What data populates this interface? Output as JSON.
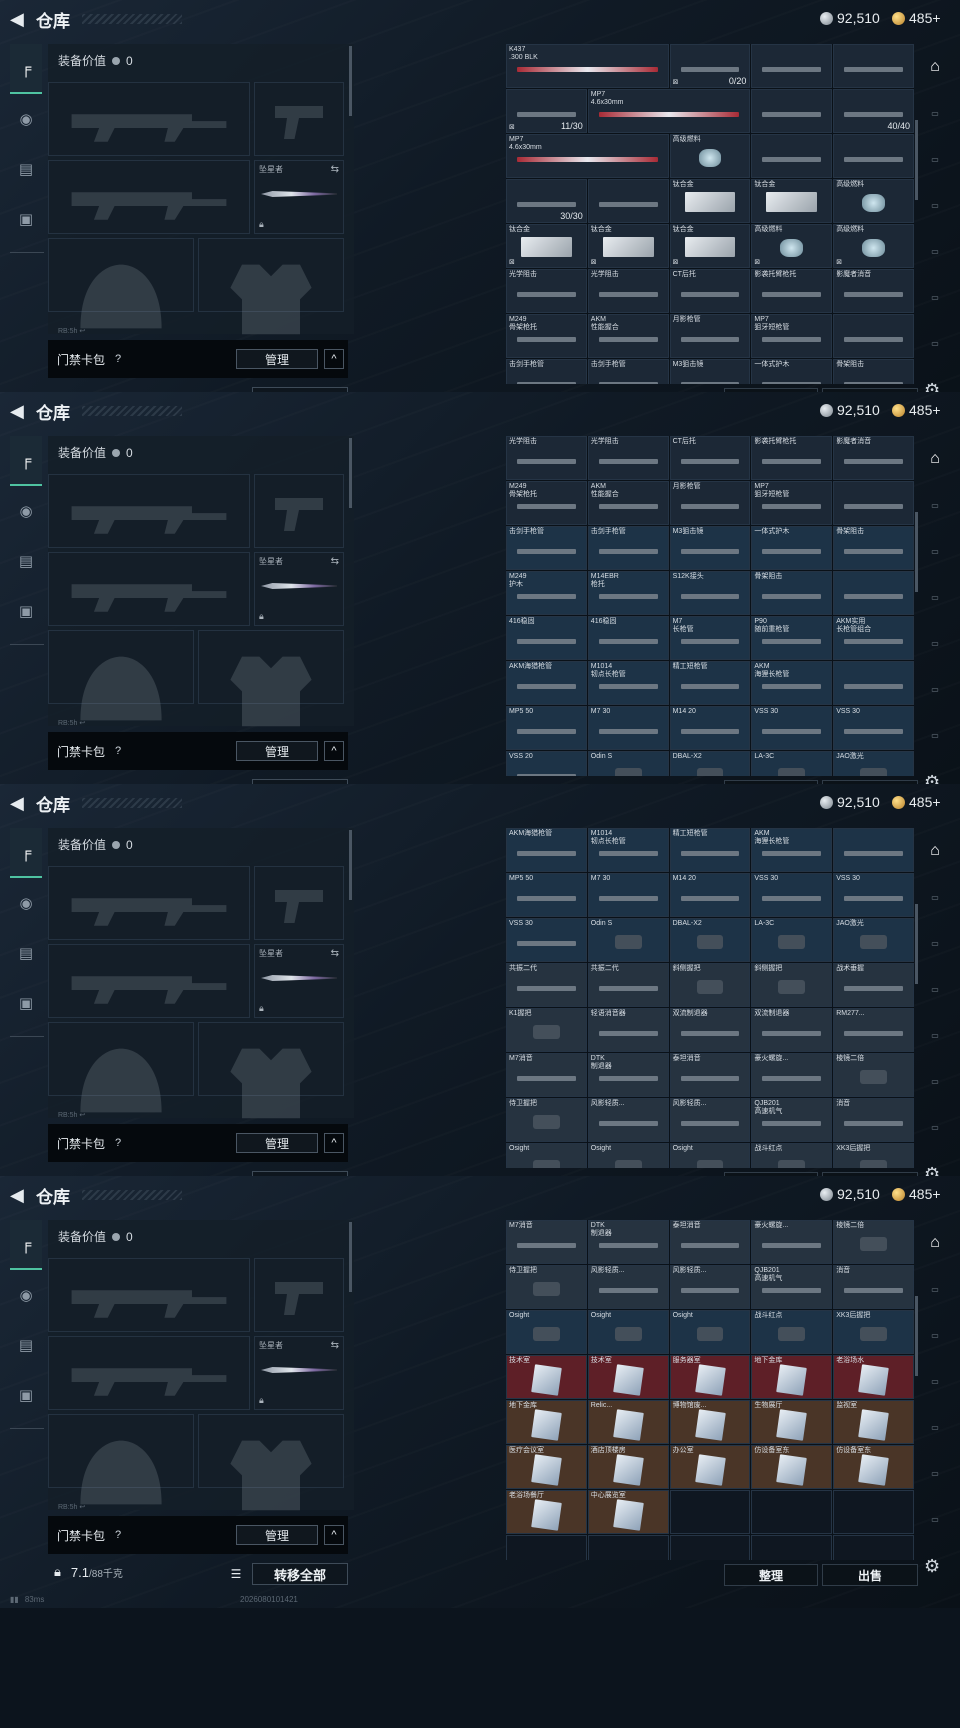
{
  "header": {
    "title": "仓库",
    "silver": "92,510",
    "gold": "485+"
  },
  "equip": {
    "value_label": "装备价值",
    "value": "0",
    "knife_label": "坠星者",
    "slot_tiny": "RB:5h  ↩"
  },
  "bag": {
    "name": "门禁卡包",
    "help": "?",
    "manage": "管理",
    "collapse": "^"
  },
  "weight": {
    "value": "7.1",
    "max": "/88千克"
  },
  "actions": {
    "transfer_all": "转移全部",
    "sort": "整理",
    "sell": "出售"
  },
  "footer": {
    "ping": "83ms",
    "code": "2026080101421"
  },
  "colors": {
    "accent": "#4fc3a1",
    "red_cell": "#5e1f27",
    "blue_cell": "#1d3347"
  },
  "frames": [
    {
      "cells": [
        {
          "name": "K437\n.300 BLK",
          "t": "red",
          "span": 2
        },
        {
          "name": "",
          "t": "",
          "cnt": "0/20",
          "badge": "⊠"
        },
        {
          "name": "",
          "t": ""
        },
        {
          "name": "",
          "t": ""
        },
        {
          "name": "",
          "t": "",
          "cnt": "11/30",
          "badge": "⊠"
        },
        {
          "name": "MP7\n4.6x30mm",
          "t": "red",
          "span": 2
        },
        {
          "name": "",
          "t": ""
        },
        {
          "name": "",
          "t": "",
          "cnt": "40/40"
        },
        {
          "name": "MP7\n4.6x30mm",
          "t": "red",
          "span": 2
        },
        {
          "name": "高级燃料",
          "t": "can"
        },
        {
          "name": "",
          "t": ""
        },
        {
          "name": "",
          "t": ""
        },
        {
          "name": "",
          "t": "",
          "cnt": "30/30"
        },
        {
          "name": "",
          "t": ""
        },
        {
          "name": "钛合金",
          "t": "box"
        },
        {
          "name": "钛合金",
          "t": "box"
        },
        {
          "name": "高级燃料",
          "t": "can"
        },
        {
          "name": "钛合金",
          "t": "box",
          "badge": "⊠"
        },
        {
          "name": "钛合金",
          "t": "box",
          "badge": "⊠"
        },
        {
          "name": "钛合金",
          "t": "box",
          "badge": "⊠"
        },
        {
          "name": "高级燃料",
          "t": "can",
          "badge": "⊠"
        },
        {
          "name": "高级燃料",
          "t": "can",
          "badge": "⊠"
        },
        {
          "name": "光学阻击",
          "t": ""
        },
        {
          "name": "光学阻击",
          "t": ""
        },
        {
          "name": "CT后托",
          "t": ""
        },
        {
          "name": "影袭托臂枪托",
          "t": ""
        },
        {
          "name": "影魔者消音",
          "t": ""
        },
        {
          "name": "M249\n骨架枪托",
          "t": ""
        },
        {
          "name": "AKM\n性能握合",
          "t": ""
        },
        {
          "name": "月影枪管",
          "t": ""
        },
        {
          "name": "MP7\n狙牙短枪管",
          "t": ""
        },
        {
          "name": "",
          "t": ""
        },
        {
          "name": "击剑手枪管",
          "t": ""
        },
        {
          "name": "击剑手枪管",
          "t": ""
        },
        {
          "name": "M3狙击镜",
          "t": ""
        },
        {
          "name": "一体式护木",
          "t": ""
        },
        {
          "name": "骨架阻击",
          "t": ""
        }
      ]
    },
    {
      "cells": [
        {
          "name": "光学阻击",
          "t": ""
        },
        {
          "name": "光学阻击",
          "t": ""
        },
        {
          "name": "CT后托",
          "t": ""
        },
        {
          "name": "影袭托臂枪托",
          "t": ""
        },
        {
          "name": "影魔者消音",
          "t": ""
        },
        {
          "name": "M249\n骨架枪托",
          "t": ""
        },
        {
          "name": "AKM\n性能握合",
          "t": ""
        },
        {
          "name": "月影枪管",
          "t": ""
        },
        {
          "name": "MP7\n狙牙短枪管",
          "t": ""
        },
        {
          "name": "",
          "t": ""
        },
        {
          "name": "击剑手枪管",
          "t": "b"
        },
        {
          "name": "击剑手枪管",
          "t": "b"
        },
        {
          "name": "M3狙击镜",
          "t": "b"
        },
        {
          "name": "一体式护木",
          "t": "b"
        },
        {
          "name": "骨架阻击",
          "t": "b"
        },
        {
          "name": "M249\n护木",
          "t": "b"
        },
        {
          "name": "M14EBR\n枪托",
          "t": "b"
        },
        {
          "name": "S12K接头",
          "t": "b"
        },
        {
          "name": "骨架阻击",
          "t": "b"
        },
        {
          "name": "",
          "t": "b"
        },
        {
          "name": "416稳固",
          "t": "b"
        },
        {
          "name": "416稳固",
          "t": "b"
        },
        {
          "name": "M7\n长枪管",
          "t": "b"
        },
        {
          "name": "P90\n随前重枪管",
          "t": "b"
        },
        {
          "name": "AKM实用\n长枪管组合",
          "t": "b"
        },
        {
          "name": "AKM海猎枪管",
          "t": "b"
        },
        {
          "name": "M1014\n韧点长枪管",
          "t": "b"
        },
        {
          "name": "精工短枪管",
          "t": "b"
        },
        {
          "name": "AKM\n海狸长枪管",
          "t": "b"
        },
        {
          "name": "",
          "t": "b"
        },
        {
          "name": "MP5 50",
          "t": "b"
        },
        {
          "name": "M7 30",
          "t": "b"
        },
        {
          "name": "M14 20",
          "t": "b"
        },
        {
          "name": "VSS 30",
          "t": "b"
        },
        {
          "name": "VSS 30",
          "t": "b"
        },
        {
          "name": "VSS 20",
          "t": "b"
        },
        {
          "name": "Odin S",
          "t": "b"
        },
        {
          "name": "DBAL-X2",
          "t": "b"
        },
        {
          "name": "LA-3C",
          "t": "b"
        },
        {
          "name": "JAO激光",
          "t": "b"
        }
      ]
    },
    {
      "cells": [
        {
          "name": "AKM海猎枪管",
          "t": "b"
        },
        {
          "name": "M1014\n韧点长枪管",
          "t": "b"
        },
        {
          "name": "精工短枪管",
          "t": "b"
        },
        {
          "name": "AKM\n海狸长枪管",
          "t": "b"
        },
        {
          "name": "",
          "t": "b"
        },
        {
          "name": "MP5 50",
          "t": "b"
        },
        {
          "name": "M7 30",
          "t": "b"
        },
        {
          "name": "M14 20",
          "t": "b"
        },
        {
          "name": "VSS 30",
          "t": "b"
        },
        {
          "name": "VSS 30",
          "t": "b"
        },
        {
          "name": "VSS 30",
          "t": "b"
        },
        {
          "name": "Odin S",
          "t": "b"
        },
        {
          "name": "DBAL-X2",
          "t": "b"
        },
        {
          "name": "LA-3C",
          "t": "b"
        },
        {
          "name": "JAO激光",
          "t": "b"
        },
        {
          "name": "共振二代",
          "t": "g"
        },
        {
          "name": "共振二代",
          "t": "g"
        },
        {
          "name": "斜侧握把",
          "t": "g"
        },
        {
          "name": "斜侧握把",
          "t": "g"
        },
        {
          "name": "战术垂握",
          "t": "g"
        },
        {
          "name": "K1握把",
          "t": "g"
        },
        {
          "name": "轻语消音器",
          "t": "g"
        },
        {
          "name": "双流制退器",
          "t": "g"
        },
        {
          "name": "双流制退器",
          "t": "g"
        },
        {
          "name": "RM277...",
          "t": "g"
        },
        {
          "name": "M7消音",
          "t": "g"
        },
        {
          "name": "DTK\n制退器",
          "t": "g"
        },
        {
          "name": "泰坦消音",
          "t": "g"
        },
        {
          "name": "豪火螺旋...",
          "t": "g"
        },
        {
          "name": "棱镜二倍",
          "t": "g"
        },
        {
          "name": "侍卫握把",
          "t": "g"
        },
        {
          "name": "风影轻质...",
          "t": "g"
        },
        {
          "name": "风影轻质...",
          "t": "g"
        },
        {
          "name": "QJB201\n高速机气",
          "t": "g"
        },
        {
          "name": "消音",
          "t": "g"
        },
        {
          "name": "Osight",
          "t": "g"
        },
        {
          "name": "Osight",
          "t": "g"
        },
        {
          "name": "Osight",
          "t": "g"
        },
        {
          "name": "战斗红点",
          "t": "g"
        },
        {
          "name": "XK3后握把",
          "t": "g"
        }
      ]
    },
    {
      "cells": [
        {
          "name": "M7消音",
          "t": "g"
        },
        {
          "name": "DTK\n制退器",
          "t": "g"
        },
        {
          "name": "泰坦消音",
          "t": "g"
        },
        {
          "name": "豪火螺旋...",
          "t": "g"
        },
        {
          "name": "棱镜二倍",
          "t": "g"
        },
        {
          "name": "侍卫握把",
          "t": "g"
        },
        {
          "name": "风影轻质...",
          "t": "g"
        },
        {
          "name": "风影轻质...",
          "t": "g"
        },
        {
          "name": "QJB201\n高速机气",
          "t": "g"
        },
        {
          "name": "消音",
          "t": "g"
        },
        {
          "name": "Osight",
          "t": "b"
        },
        {
          "name": "Osight",
          "t": "b"
        },
        {
          "name": "Osight",
          "t": "b"
        },
        {
          "name": "战斗红点",
          "t": "b"
        },
        {
          "name": "XK3后握把",
          "t": "b"
        },
        {
          "name": "技术室",
          "t": "r"
        },
        {
          "name": "技术室",
          "t": "r"
        },
        {
          "name": "服务器室",
          "t": "r"
        },
        {
          "name": "地下金库",
          "t": "r"
        },
        {
          "name": "老浴场水",
          "t": "r"
        },
        {
          "name": "地下金库",
          "t": "br"
        },
        {
          "name": "Relic...",
          "t": "br"
        },
        {
          "name": "博物馆废...",
          "t": "br"
        },
        {
          "name": "生物展厅",
          "t": "br"
        },
        {
          "name": "监视室",
          "t": "br"
        },
        {
          "name": "医疗会议室",
          "t": "br"
        },
        {
          "name": "酒店顶楼房",
          "t": "br"
        },
        {
          "name": "办公室",
          "t": "br"
        },
        {
          "name": "仿设备室东",
          "t": "br"
        },
        {
          "name": "仿设备室东",
          "t": "br"
        },
        {
          "name": "老浴场餐厅",
          "t": "br"
        },
        {
          "name": "中心展览室",
          "t": "br"
        },
        {
          "name": "",
          "t": "e"
        },
        {
          "name": "",
          "t": "e"
        },
        {
          "name": "",
          "t": "e"
        },
        {
          "name": "",
          "t": "e"
        },
        {
          "name": "",
          "t": "e"
        },
        {
          "name": "",
          "t": "e"
        },
        {
          "name": "",
          "t": "e"
        },
        {
          "name": "",
          "t": "e"
        }
      ]
    }
  ]
}
